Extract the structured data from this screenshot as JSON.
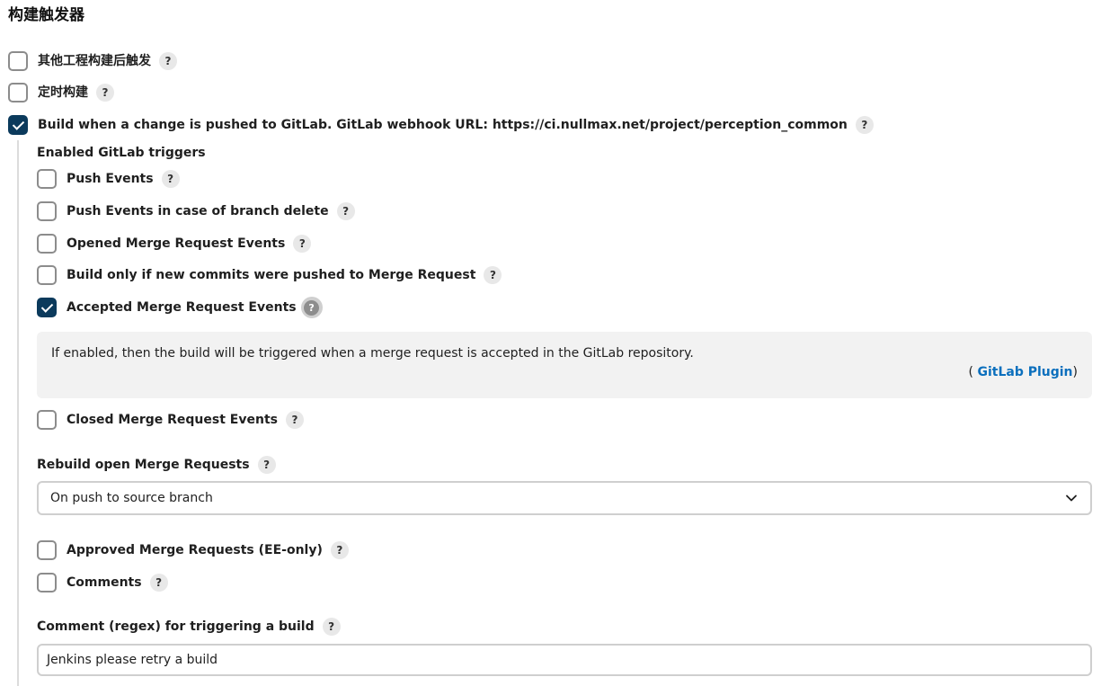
{
  "section": {
    "title": "构建触发器"
  },
  "triggers": {
    "other_project": {
      "label": "其他工程构建后触发",
      "checked": false
    },
    "periodic": {
      "label": "定时构建",
      "checked": false
    },
    "gitlab": {
      "label": "Build when a change is pushed to GitLab. GitLab webhook URL: https://ci.nullmax.net/project/perception_common",
      "checked": true
    }
  },
  "gitlab": {
    "enabled_heading": "Enabled GitLab triggers",
    "push_events": {
      "label": "Push Events",
      "checked": false
    },
    "push_branch_delete": {
      "label": "Push Events in case of branch delete",
      "checked": false
    },
    "opened_mr": {
      "label": "Opened Merge Request Events",
      "checked": false
    },
    "build_new_commits": {
      "label": "Build only if new commits were pushed to Merge Request",
      "checked": false
    },
    "accepted_mr": {
      "label": "Accepted Merge Request Events",
      "checked": true
    },
    "accepted_help": {
      "text": "If enabled, then the build will be triggered when a merge request is accepted in the GitLab repository.",
      "source_open": "(",
      "source_link": "GitLab Plugin",
      "source_close": ")"
    },
    "closed_mr": {
      "label": "Closed Merge Request Events",
      "checked": false
    },
    "rebuild": {
      "label": "Rebuild open Merge Requests",
      "selected": "On push to source branch"
    },
    "approved_mr": {
      "label": "Approved Merge Requests (EE-only)",
      "checked": false
    },
    "comments": {
      "label": "Comments",
      "checked": false
    },
    "comment_regex": {
      "label": "Comment (regex) for triggering a build",
      "value": "Jenkins please retry a build"
    }
  },
  "help_glyph": "?",
  "icons": {
    "help": "question-mark-icon",
    "dropdown": "chevron-down-icon",
    "check": "checkmark-icon"
  }
}
